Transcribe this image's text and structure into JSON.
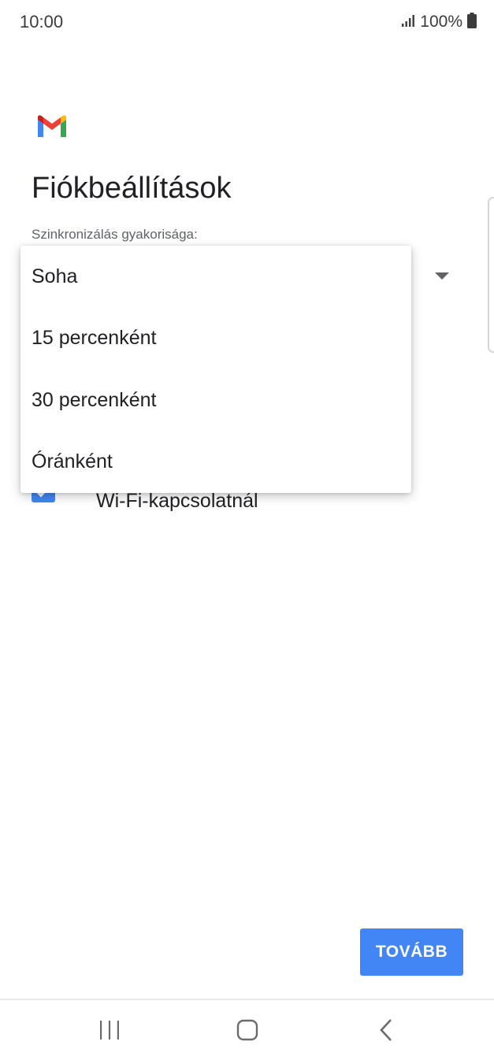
{
  "status_bar": {
    "time": "10:00",
    "battery_percent": "100%",
    "icons": [
      "signal-icon",
      "battery-icon"
    ]
  },
  "app": {
    "logo": "gmail-logo-icon"
  },
  "page": {
    "title": "Fiókbeállítások",
    "sync_label": "Szinkronizálás gyakorisága:"
  },
  "sync_dropdown": {
    "expanded": true,
    "options": [
      "Soha",
      "15 percenként",
      "30 percenként",
      "Óránként"
    ]
  },
  "wifi_checkbox": {
    "checked": true,
    "label": "Wi-Fi-kapcsolatnál"
  },
  "actions": {
    "next_label": "TOVÁBB"
  },
  "colors": {
    "accent": "#4285f4",
    "text": "#202124",
    "secondary_text": "#5f6368"
  },
  "nav": {
    "icons": [
      "recent-apps-icon",
      "home-icon",
      "back-icon"
    ]
  }
}
